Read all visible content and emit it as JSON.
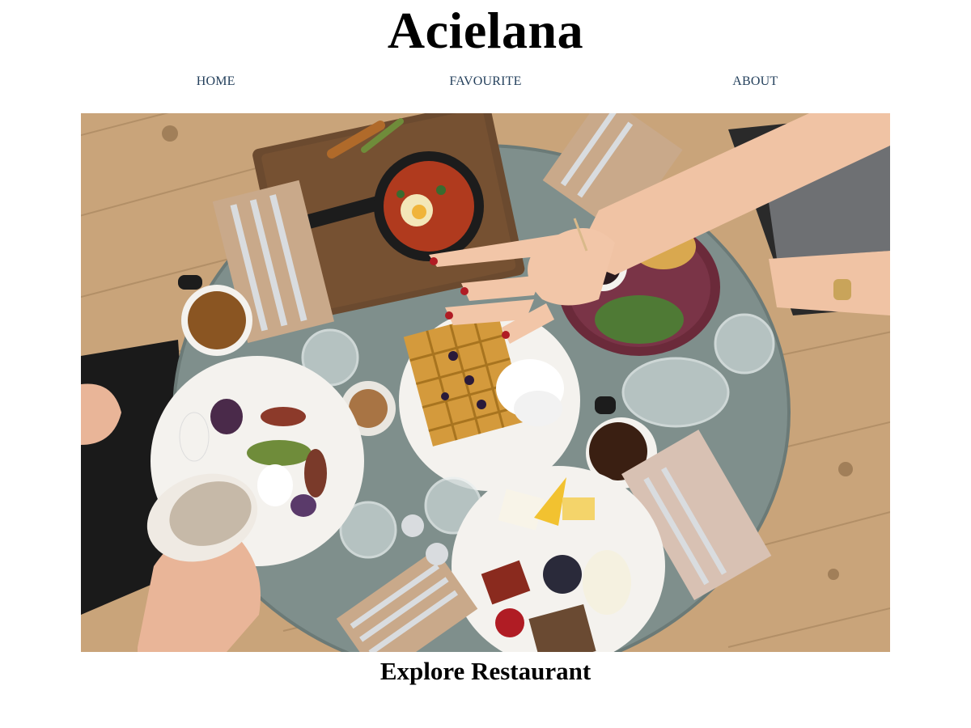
{
  "site": {
    "title": "Acielana"
  },
  "nav": {
    "items": [
      {
        "label": "HOME"
      },
      {
        "label": "FAVOURITE"
      },
      {
        "label": "ABOUT"
      }
    ],
    "link_color": "#24405c"
  },
  "hero": {
    "caption": "Explore Restaurant"
  },
  "colors": {
    "floor": "#c9a47a",
    "table": "#7f8f8c",
    "plate": "#f4f2ee",
    "board": "#6b4a2f"
  }
}
